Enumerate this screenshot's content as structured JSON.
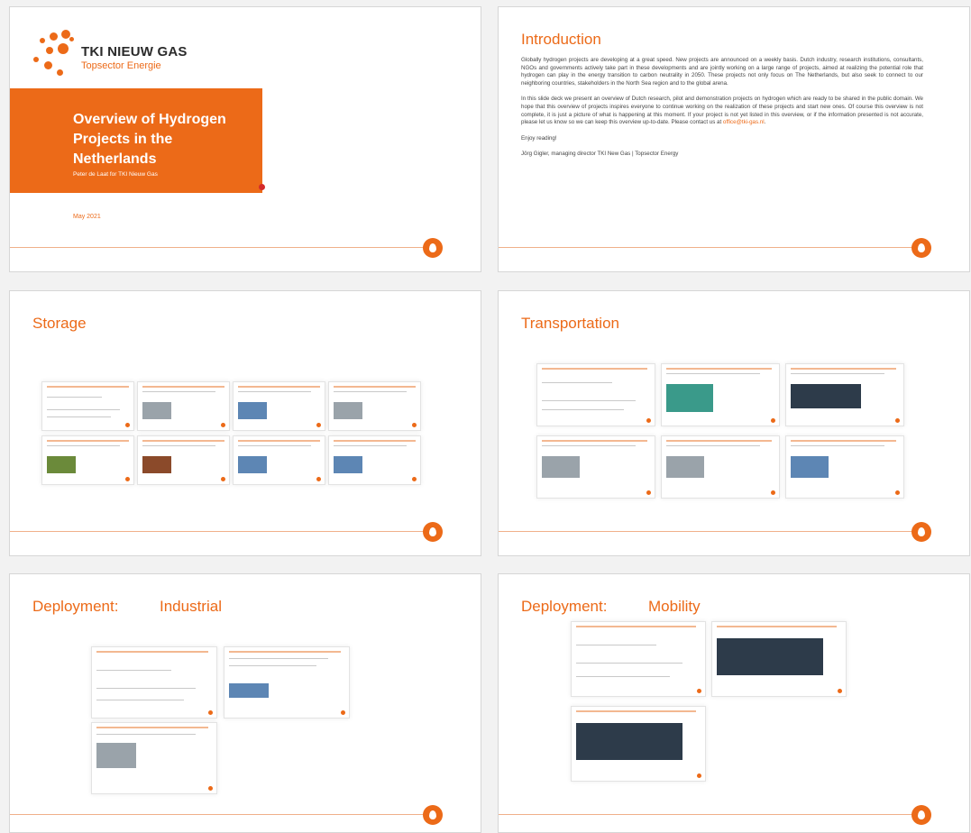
{
  "title_slide": {
    "logo_main": "TKI NIEUW GAS",
    "logo_sub": "Topsector Energie",
    "title": "Overview of Hydrogen Projects in the Netherlands",
    "author": "Peter de Laat for TKI Nieuw Gas",
    "date": "May 2021"
  },
  "intro_slide": {
    "title": "Introduction",
    "para1": "Globally hydrogen projects are developing at a great speed. New projects are announced on a weekly basis. Dutch industry, research institutions, consultants, NGOs and governments actively take part in these developments and are jointly working on a large range of projects, aimed at realizing the potential role that hydrogen can play in the energy transition to carbon neutrality in 2050. These projects not only focus on The Netherlands, but also seek to connect to our neighboring countries, stakeholders in the North Sea region and to the global arena.",
    "para2_start": "In this slide deck we present an overview of Dutch research, pilot and demonstration projects on hydrogen which are ready to be shared in the public domain. We hope that this overview of projects inspires everyone to continue working on the realization of these projects and start new ones. Of course this overview is not complete, it is just a picture of what is happening at this moment. If your project is not yet listed in this overview, or if the information presented is not accurate, please let us know so we can keep this overview up-to-date. Please contact us at ",
    "email": "office@tki-gas.nl",
    "para2_end": ".",
    "para3": "Enjoy reading!",
    "signature": "Jörg Gigler, managing director TKI New Gas | Topsector Energy"
  },
  "storage_slide": {
    "title": "Storage"
  },
  "transportation_slide": {
    "title": "Transportation"
  },
  "industrial_slide": {
    "title_left": "Deployment:",
    "title_right": "Industrial"
  },
  "mobility_slide": {
    "title_left": "Deployment:",
    "title_right": "Mobility"
  },
  "colors": {
    "accent": "#ec6a18",
    "frame": "#f2f2f2"
  }
}
